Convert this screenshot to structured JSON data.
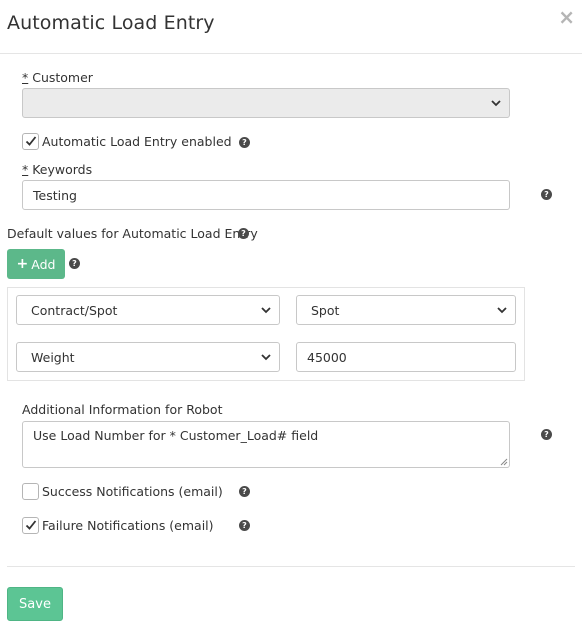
{
  "header": {
    "title": "Automatic Load Entry",
    "close_glyph": "×"
  },
  "customer": {
    "required_mark": "*",
    "label": " Customer",
    "value": ""
  },
  "auto_entry": {
    "label": "Automatic Load Entry enabled",
    "checked": true
  },
  "keywords": {
    "required_mark": "*",
    "label": " Keywords",
    "value": "Testing"
  },
  "defaults": {
    "label": "Default values for Automatic Load Entry",
    "add_label": "Add",
    "rows": [
      {
        "field": "Contract/Spot",
        "value": "Spot",
        "value_is_select": true
      },
      {
        "field": "Weight",
        "value": "45000",
        "value_is_select": false
      }
    ]
  },
  "robot_info": {
    "label": "Additional Information for Robot",
    "value": "Use Load Number for * Customer_Load# field"
  },
  "notifications": {
    "success": {
      "label": "Success Notifications (email)",
      "checked": false
    },
    "failure": {
      "label": "Failure Notifications (email)",
      "checked": true
    }
  },
  "footer": {
    "save_label": "Save"
  },
  "help_glyph": "?",
  "colors": {
    "accent": "#5cb88a",
    "save": "#5cc594",
    "help": "#4a4a4a",
    "disabled_bg": "#ebebeb"
  },
  "icons": [
    "close-icon",
    "chevron-down-icon",
    "help-icon",
    "check-icon",
    "plus-icon"
  ]
}
